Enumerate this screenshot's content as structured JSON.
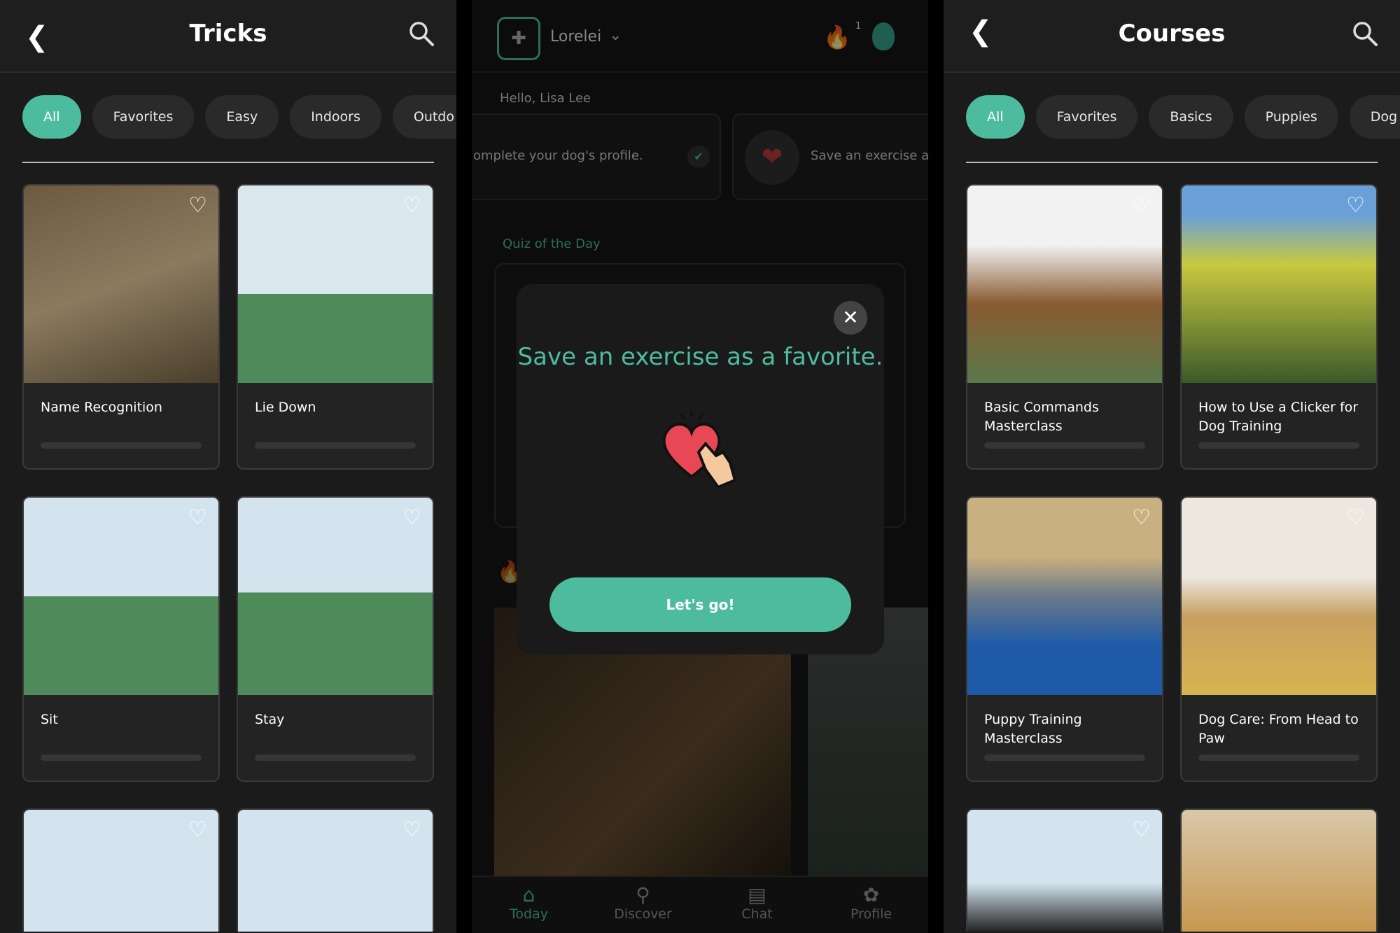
{
  "tricks": {
    "title": "Tricks",
    "chips": [
      "All",
      "Favorites",
      "Easy",
      "Indoors",
      "Outdo"
    ],
    "cards": [
      {
        "name": "Name Recognition"
      },
      {
        "name": "Lie Down"
      },
      {
        "name": "Sit"
      },
      {
        "name": "Stay"
      },
      {
        "name": ""
      },
      {
        "name": ""
      }
    ]
  },
  "today": {
    "dog_name": "Lorelei",
    "streak": "1",
    "greeting": "Hello, Lisa Lee",
    "task1": "omplete your dog's profile.",
    "task2": "Save an exercise as",
    "quiz_title": "Quiz of the Day",
    "modal": {
      "title": "Save an exercise as a favorite.",
      "button": "Let's go!"
    },
    "nav": [
      {
        "label": "Today",
        "icon": "home"
      },
      {
        "label": "Discover",
        "icon": "search"
      },
      {
        "label": "Chat",
        "icon": "chat"
      },
      {
        "label": "Profile",
        "icon": "paw"
      }
    ],
    "accent": "#4dbc9e"
  },
  "courses": {
    "title": "Courses",
    "chips": [
      "All",
      "Favorites",
      "Basics",
      "Puppies",
      "Dog"
    ],
    "cards": [
      {
        "name": "Basic Commands Masterclass"
      },
      {
        "name": "How to Use a Clicker for Dog Training"
      },
      {
        "name": "Puppy Training Masterclass"
      },
      {
        "name": "Dog Care: From Head to Paw"
      },
      {
        "name": ""
      },
      {
        "name": ""
      }
    ]
  }
}
